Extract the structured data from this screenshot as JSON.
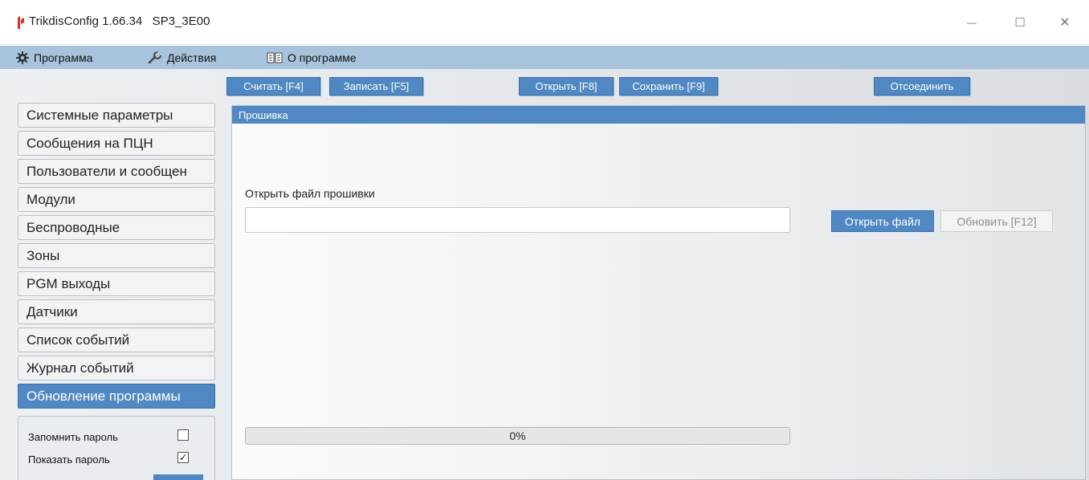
{
  "window": {
    "title": "TrikdisConfig 1.66.34   SP3_3E00",
    "minimize": "—",
    "maximize": "☐",
    "close": "✕"
  },
  "menu": {
    "program": "Программа",
    "actions": "Действия",
    "about": "О программе"
  },
  "toolbar": {
    "read": "Считать [F4]",
    "write": "Записать [F5]",
    "open": "Открыть [F8]",
    "save": "Сохранить [F9]",
    "disconnect": "Отсоединить"
  },
  "sidebar": {
    "items": [
      "Системные параметры",
      "Сообщения на ПЦН",
      "Пользователи и сообщен",
      "Модули",
      "Беспроводные",
      "Зоны",
      "PGM выходы",
      "Датчики",
      "Список событий",
      "Журнал событий",
      "Обновление программы"
    ],
    "active_index": 10
  },
  "options": {
    "remember_password": "Запомнить пароль",
    "remember_checked": false,
    "show_password": "Показать пароль",
    "show_checked": true,
    "checkmark": "✓"
  },
  "panel": {
    "title": "Прошивка",
    "file_label": "Открыть файл прошивки",
    "file_value": "",
    "open_file_button": "Открыть файл",
    "update_button": "Обновить [F12]",
    "progress_text": "0%",
    "progress_fraction": 0
  },
  "colors": {
    "accent": "#4f88c2",
    "menubar": "#a7c4dc",
    "app_icon": "#d9342b"
  }
}
